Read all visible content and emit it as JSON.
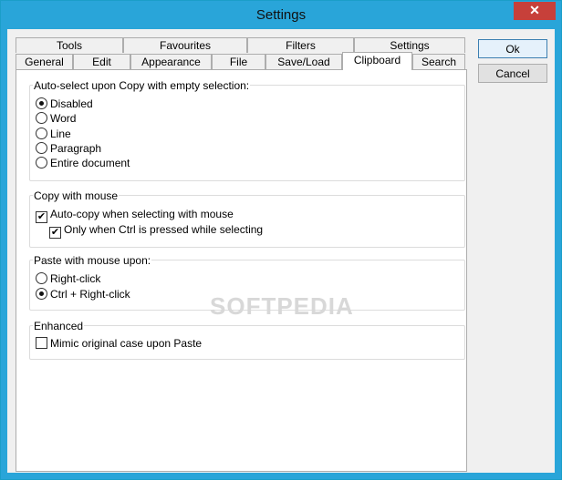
{
  "window": {
    "title": "Settings",
    "close_glyph": "✕"
  },
  "tabs": {
    "row1": [
      "Tools",
      "Favourites",
      "Filters",
      "Settings"
    ],
    "row2": [
      "General",
      "Edit",
      "Appearance",
      "File",
      "Save/Load",
      "Clipboard",
      "Search"
    ],
    "active": "Clipboard"
  },
  "buttons": {
    "ok": "Ok",
    "cancel": "Cancel"
  },
  "auto_select": {
    "label": "Auto-select upon Copy with empty selection:",
    "options": [
      "Disabled",
      "Word",
      "Line",
      "Paragraph",
      "Entire document"
    ],
    "selected": "Disabled"
  },
  "copy_mouse": {
    "label": "Copy with mouse",
    "auto_copy": {
      "label": "Auto-copy when selecting with mouse",
      "checked": true
    },
    "only_ctrl": {
      "label": "Only when Ctrl is pressed while selecting",
      "checked": true
    }
  },
  "paste_mouse": {
    "label": "Paste with mouse upon:",
    "options": [
      "Right-click",
      "Ctrl + Right-click"
    ],
    "selected": "Ctrl + Right-click"
  },
  "enhanced": {
    "label": "Enhanced",
    "mimic": {
      "label": "Mimic original case upon Paste",
      "checked": false
    }
  },
  "watermark": "SOFTPEDIA"
}
